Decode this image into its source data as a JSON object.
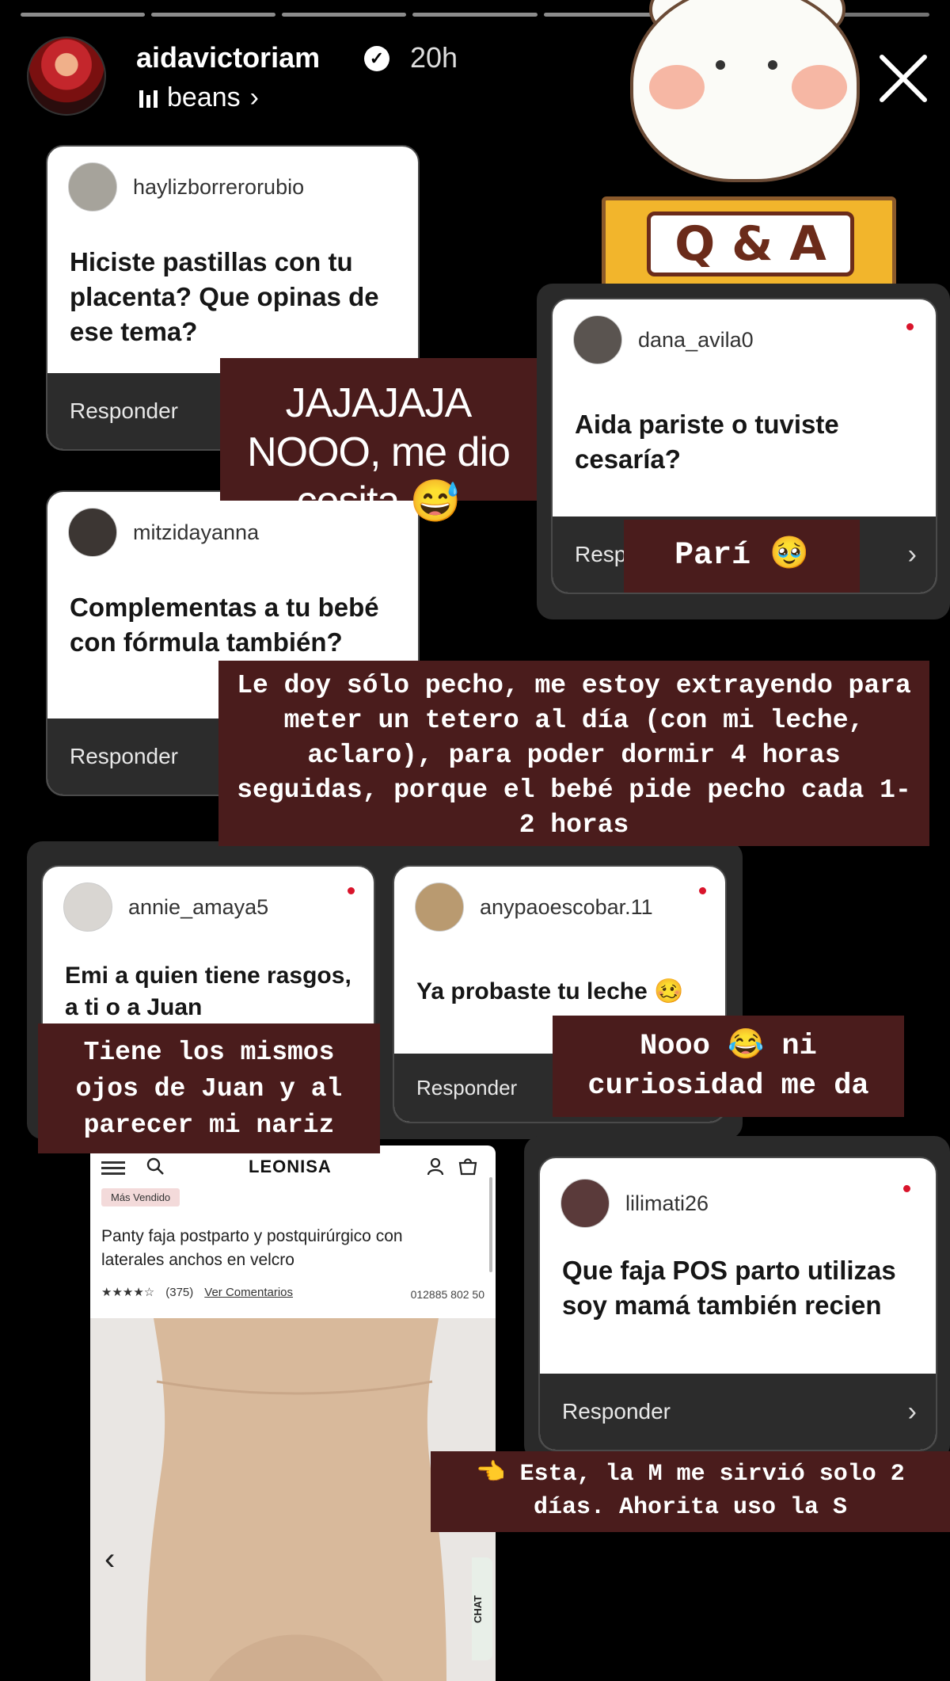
{
  "story": {
    "username": "aidavictoriam",
    "time_ago": "20h",
    "music": "beans",
    "segments": 7
  },
  "sticker": {
    "label": "Q & A"
  },
  "questions": [
    {
      "asker": "haylizborrerorubio",
      "text": "Hiciste pastillas con tu placenta? Que opinas de ese tema?",
      "reply": "Responder"
    },
    {
      "asker": "dana_avila0",
      "text": "Aida pariste o tuviste cesaría?",
      "reply": "Resp"
    },
    {
      "asker": "mitzidayanna",
      "text": "Complementas a tu bebé con fórmula también?",
      "reply": "Responder"
    },
    {
      "asker": "annie_amaya5",
      "text": "Emi a quien tiene rasgos, a ti o a Juan",
      "reply": ""
    },
    {
      "asker": "anypaoescobar.11",
      "text": "Ya probaste tu leche 🥴",
      "reply": "Responder"
    },
    {
      "asker": "lilimati26",
      "text": "Que faja POS parto utilizas soy mamá también recien",
      "reply": "Responder"
    }
  ],
  "answers": {
    "a1": "JAJAJAJA NOOO, me dio cosita 😅",
    "a2": "Parí 🥹",
    "a3": "Le doy sólo pecho, me estoy extrayendo para meter un tetero al día (con mi leche, aclaro), para poder dormir 4 horas seguidas, porque el bebé pide pecho cada 1-2 horas",
    "a4": "Tiene los mismos ojos de Juan y al parecer mi nariz",
    "a5": "Nooo 😂 ni curiosidad me da",
    "a6": "👈 Esta, la M me sirvió solo 2 días. Ahorita uso la S"
  },
  "shop": {
    "logo": "LEONISA",
    "badge": "Más Vendido",
    "title": "Panty faja postparto y postquirúrgico con laterales anchos en velcro",
    "stars": "★★★★☆",
    "reviews": "(375)",
    "reviews_link": "Ver Comentarios",
    "sku": "012885 802 50",
    "chat": "CHAT"
  },
  "colors": {
    "answer_bg": "#4a1c1c",
    "reply_bar": "#2c2c2c",
    "dot": "#d9142b"
  }
}
